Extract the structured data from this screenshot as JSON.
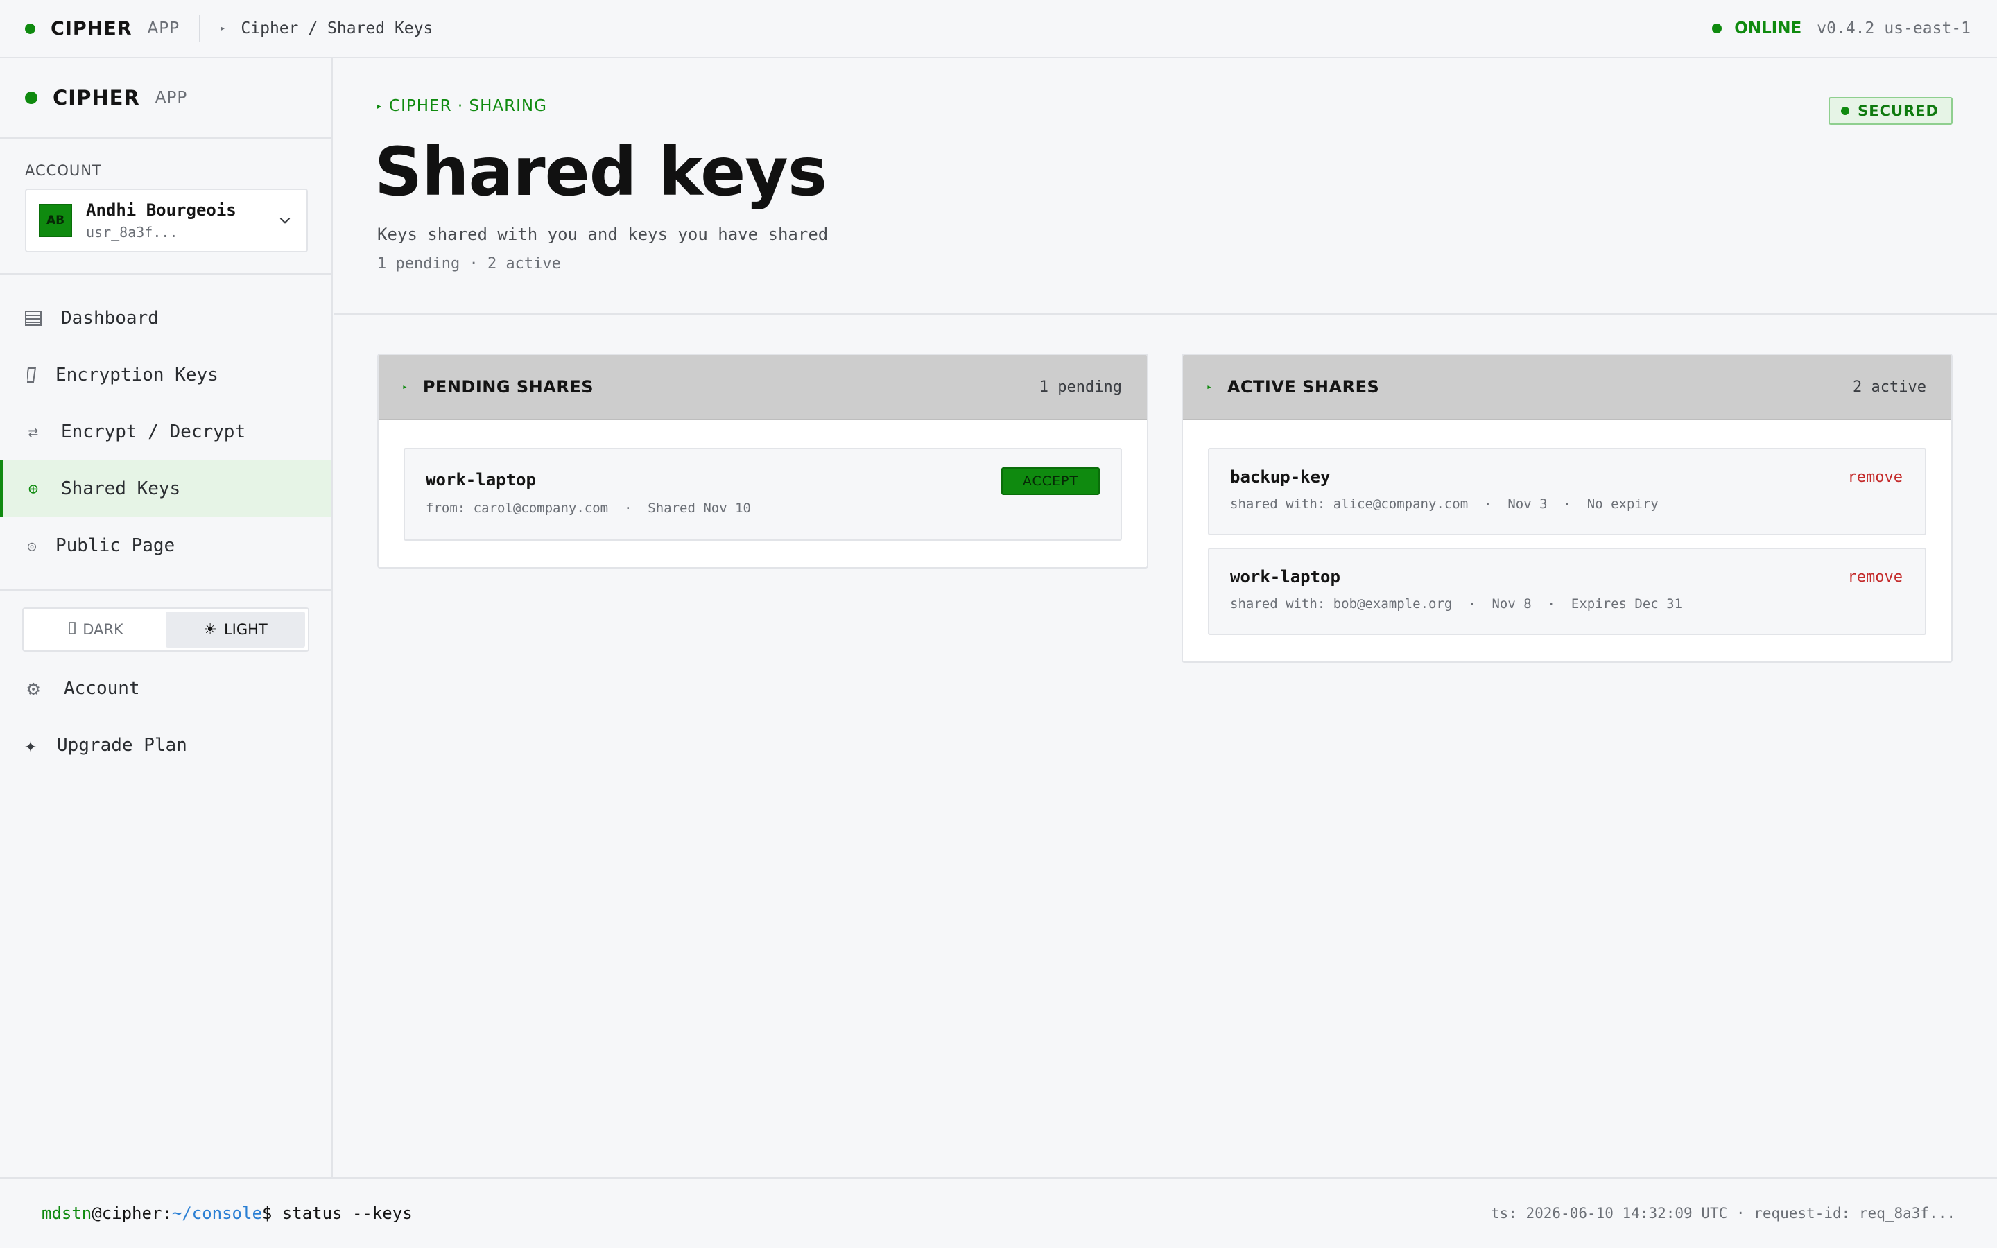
{
  "topbar": {
    "brand": "CIPHER",
    "brand_suffix": "APP",
    "breadcrumb": "Cipher / Shared Keys",
    "status": "ONLINE",
    "version": "v0.4.2",
    "region": "us-east-1"
  },
  "sidebar": {
    "brand": "CIPHER",
    "brand_suffix": "APP",
    "account_label": "ACCOUNT",
    "account": {
      "initials": "AB",
      "name": "Andhi Bourgeois",
      "user_id": "usr_8a3f..."
    },
    "nav": [
      {
        "label": "Dashboard",
        "icon": "dashboard-icon"
      },
      {
        "label": "Encryption Keys",
        "icon": "key-icon"
      },
      {
        "label": "Encrypt / Decrypt",
        "icon": "swap-icon"
      },
      {
        "label": "Shared Keys",
        "icon": "share-icon",
        "active": true
      },
      {
        "label": "Public Page",
        "icon": "globe-icon"
      }
    ],
    "theme": {
      "dark_label": "DARK",
      "light_label": "LIGHT",
      "selected": "light"
    },
    "bottom_nav": [
      {
        "label": "Account",
        "icon": "gear-icon"
      },
      {
        "label": "Upgrade Plan",
        "icon": "sparkle-icon"
      }
    ]
  },
  "header": {
    "kicker": "CIPHER · SHARING",
    "title": "Shared keys",
    "subtitle": "Keys shared with you and keys you have shared",
    "counts": "1 pending · 2 active",
    "badge": "SECURED"
  },
  "pending": {
    "title": "PENDING SHARES",
    "count": "1 pending",
    "items": [
      {
        "name": "work-laptop",
        "meta": "from: carol@company.com  ·  Shared Nov 10",
        "action": "ACCEPT"
      }
    ]
  },
  "active": {
    "title": "ACTIVE SHARES",
    "count": "2 active",
    "items": [
      {
        "name": "backup-key",
        "meta": "shared with: alice@company.com  ·  Nov 3  ·  No expiry",
        "action": "remove"
      },
      {
        "name": "work-laptop",
        "meta": "shared with: bob@example.org  ·  Nov 8  ·  Expires Dec 31",
        "action": "remove"
      }
    ]
  },
  "footer": {
    "user": "mdstn",
    "host": "@cipher:",
    "path": "~/console",
    "prompt_symbol": "$",
    "command": "status --keys",
    "meta": "ts: 2026-06-10 14:32:09 UTC · request-id: req_8a3f..."
  },
  "colors": {
    "accent": "#0f8a0f",
    "danger": "#c42b2b",
    "path": "#2a7fd4"
  }
}
